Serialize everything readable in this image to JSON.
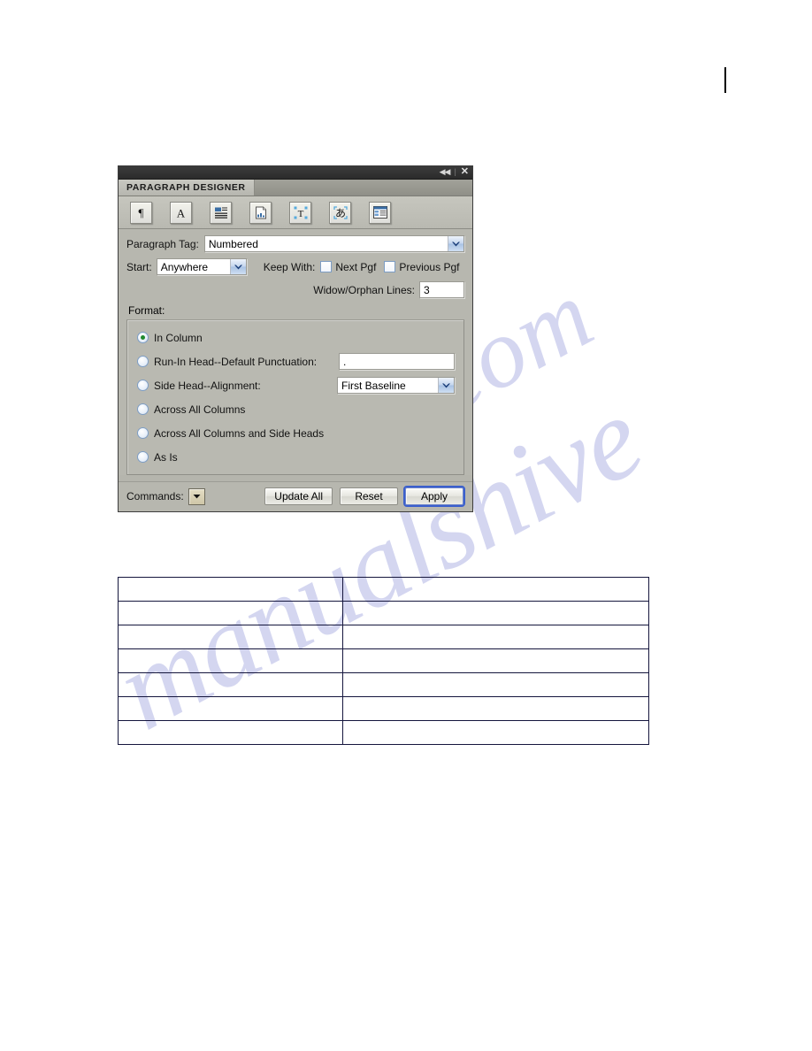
{
  "page": {
    "watermark_text_left": "manualshive",
    "watermark_text_right": ".com",
    "change_bar_color": "#000000"
  },
  "panel": {
    "titlebar": {
      "collapse_icon": "◀◀",
      "separator": "|",
      "close_icon": "✕"
    },
    "tab_label": "PARAGRAPH DESIGNER",
    "toolbar": {
      "icons": [
        {
          "name": "pilcrow-basic-icon",
          "glyph": "¶",
          "title": "Basic"
        },
        {
          "name": "font-icon",
          "glyph": "A",
          "title": "Default Font"
        },
        {
          "name": "pagination-lines-icon",
          "glyph": "",
          "title": "Pagination"
        },
        {
          "name": "page-layout-icon",
          "glyph": "",
          "title": "Numbering"
        },
        {
          "name": "text-frame-icon",
          "glyph": "T",
          "title": "Advanced"
        },
        {
          "name": "asian-typography-icon",
          "glyph": "あ",
          "title": "Asian"
        },
        {
          "name": "table-cell-icon",
          "glyph": "",
          "title": "Table Cell"
        }
      ]
    },
    "fields": {
      "paragraph_tag_label": "Paragraph Tag:",
      "paragraph_tag_value": "Numbered",
      "start_label": "Start:",
      "start_value": "Anywhere",
      "keep_with_label": "Keep With:",
      "next_pgf_label": "Next Pgf",
      "next_pgf_checked": false,
      "previous_pgf_label": "Previous Pgf",
      "previous_pgf_checked": false,
      "widow_orphan_label": "Widow/Orphan Lines:",
      "widow_orphan_value": "3"
    },
    "format": {
      "section_label": "Format:",
      "selected": "In Column",
      "options": [
        {
          "label": "In Column",
          "selected": true
        },
        {
          "label": "Run-In Head--Default Punctuation:",
          "selected": false
        },
        {
          "label": "Side Head--Alignment:",
          "selected": false
        },
        {
          "label": "Across All Columns",
          "selected": false
        },
        {
          "label": "Across All Columns and Side Heads",
          "selected": false
        },
        {
          "label": "As Is",
          "selected": false
        }
      ],
      "punctuation_value": ".",
      "side_head_alignment_value": "First Baseline"
    },
    "commands": {
      "label": "Commands:",
      "menu_icon": "▼",
      "update_all_label": "Update All",
      "reset_label": "Reset",
      "apply_label": "Apply",
      "default_button": "Apply"
    }
  },
  "table": {
    "rows": [
      {
        "col1": "",
        "col2": ""
      },
      {
        "col1": "",
        "col2": ""
      },
      {
        "col1": "",
        "col2": ""
      },
      {
        "col1": "",
        "col2": ""
      },
      {
        "col1": "",
        "col2": ""
      },
      {
        "col1": "",
        "col2": ""
      },
      {
        "col1": "",
        "col2": ""
      }
    ]
  }
}
